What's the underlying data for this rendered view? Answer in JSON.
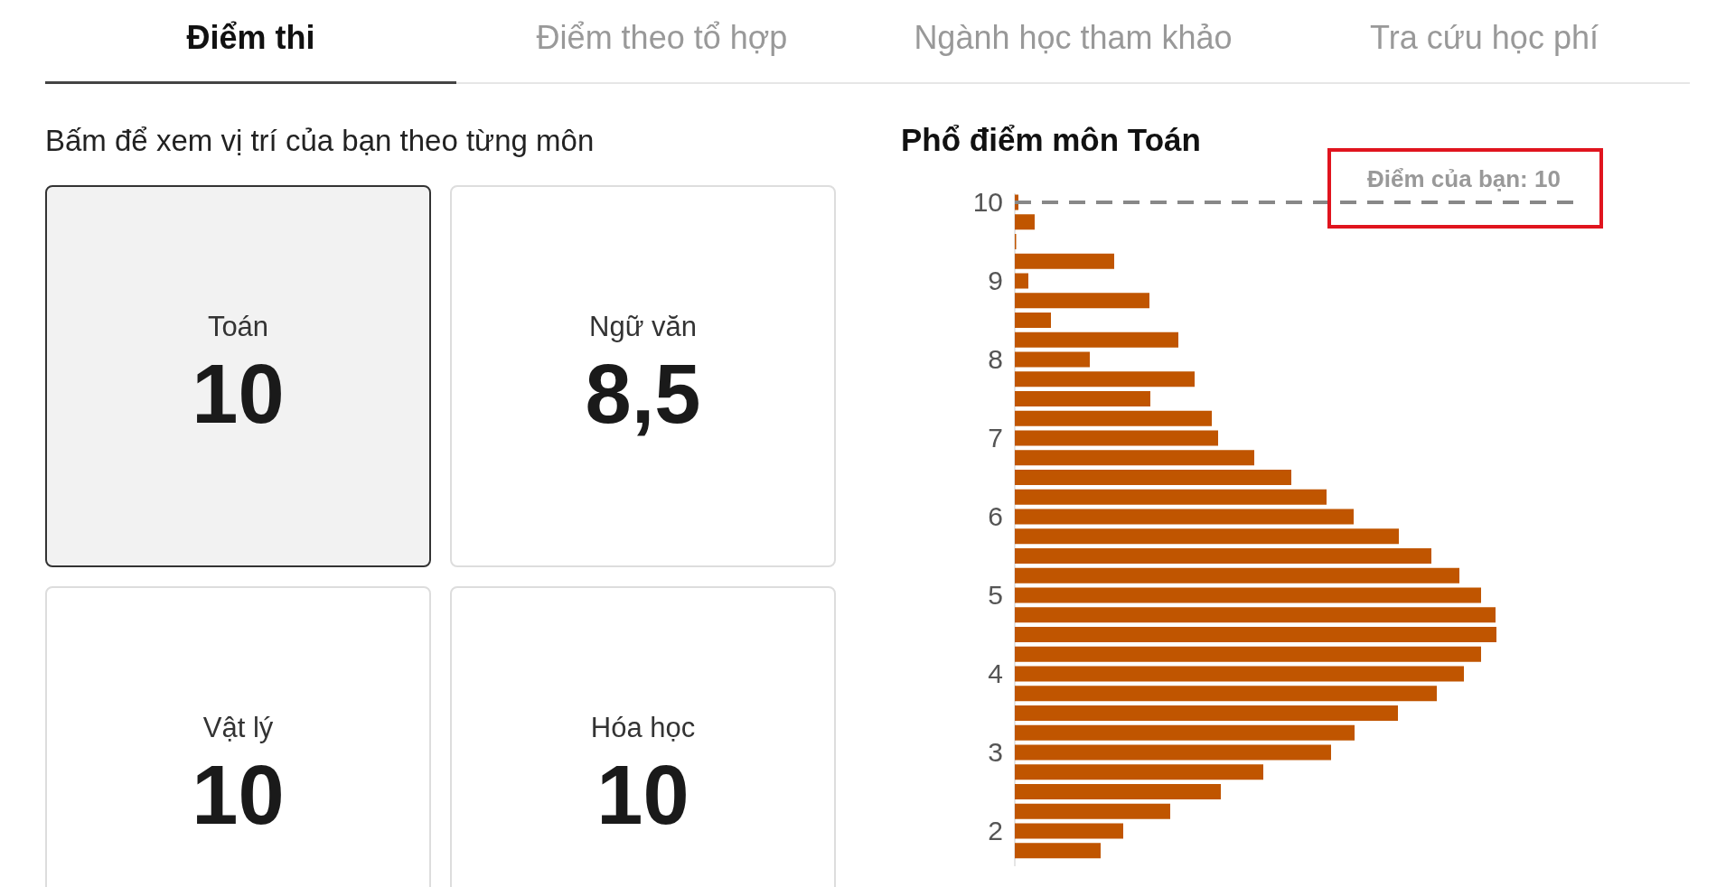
{
  "tabs": [
    {
      "label": "Điểm thi",
      "selected": true
    },
    {
      "label": "Điểm theo tổ hợp",
      "selected": false
    },
    {
      "label": "Ngành học tham khảo",
      "selected": false
    },
    {
      "label": "Tra cứu học phí",
      "selected": false
    }
  ],
  "instruction": "Bấm để xem vị trí của bạn theo từng môn",
  "subjects": [
    {
      "name": "Toán",
      "score": "10",
      "selected": true
    },
    {
      "name": "Ngữ văn",
      "score": "8,5",
      "selected": false
    },
    {
      "name": "Vật lý",
      "score": "10",
      "selected": false
    },
    {
      "name": "Hóa học",
      "score": "10",
      "selected": false
    }
  ],
  "distribution": {
    "title": "Phổ điểm môn Toán",
    "axis_labels": [
      "10",
      "9",
      "8",
      "7",
      "6",
      "5",
      "4",
      "3",
      "2"
    ],
    "your_score_label": "Điểm của bạn: 10"
  }
}
